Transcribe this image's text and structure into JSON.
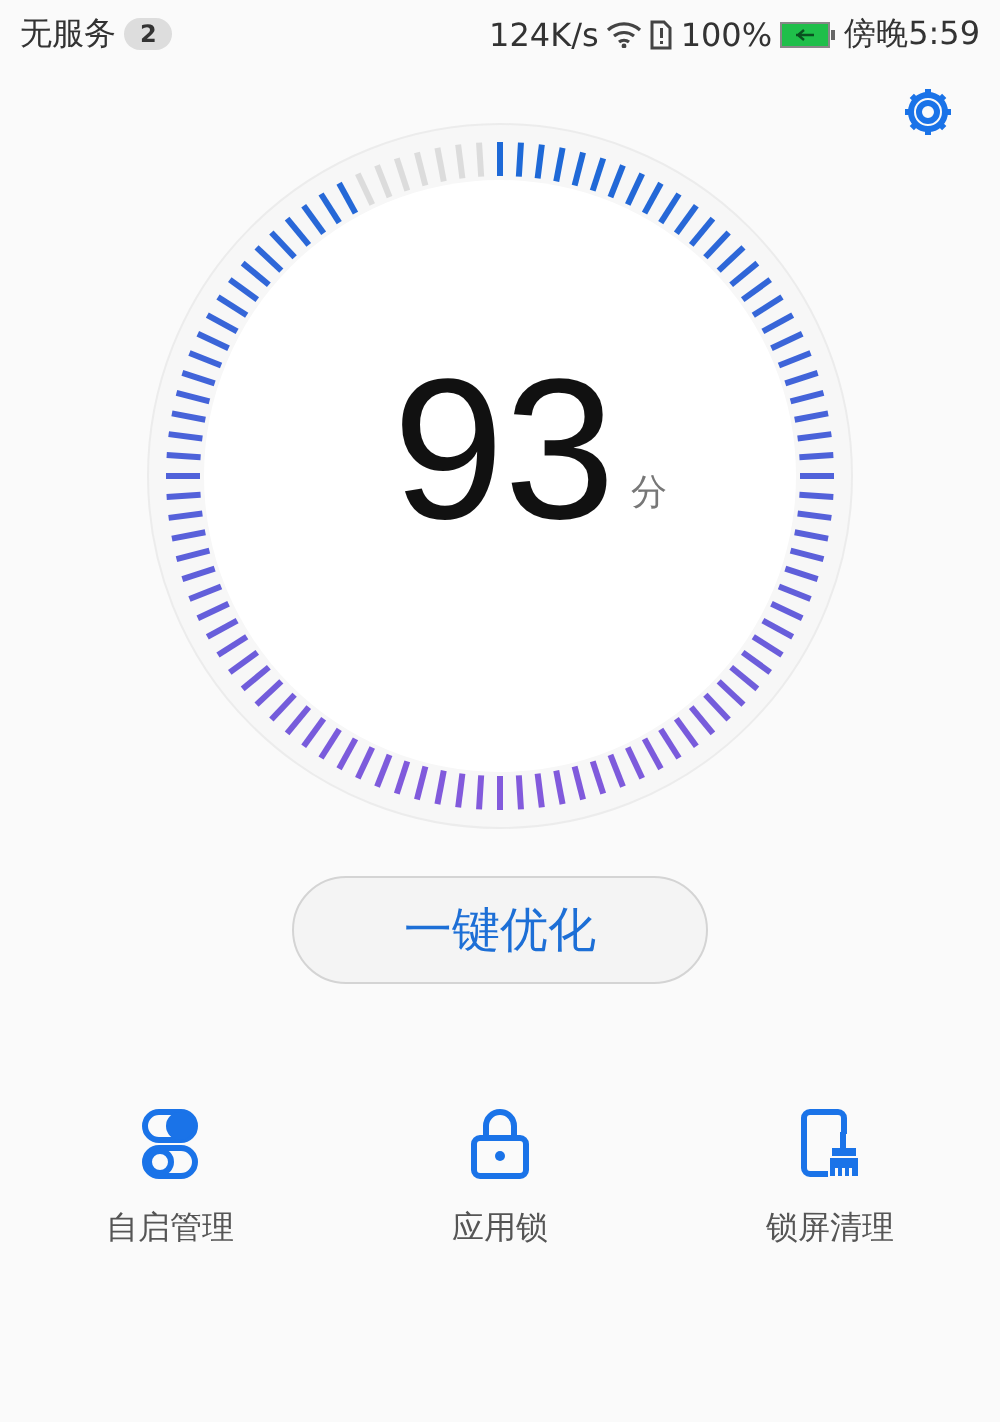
{
  "status_bar": {
    "carrier": "无服务",
    "notification_count": "2",
    "speed": "124K/s",
    "battery": "100%",
    "time": "傍晚5:59"
  },
  "gauge": {
    "score": "93",
    "unit": "分"
  },
  "optimize_button": {
    "label": "一键优化"
  },
  "shortcuts": [
    {
      "kind": "autostart",
      "label": "自启管理"
    },
    {
      "kind": "applock",
      "label": "应用锁"
    },
    {
      "kind": "screenclean",
      "label": "锁屏清理"
    }
  ]
}
